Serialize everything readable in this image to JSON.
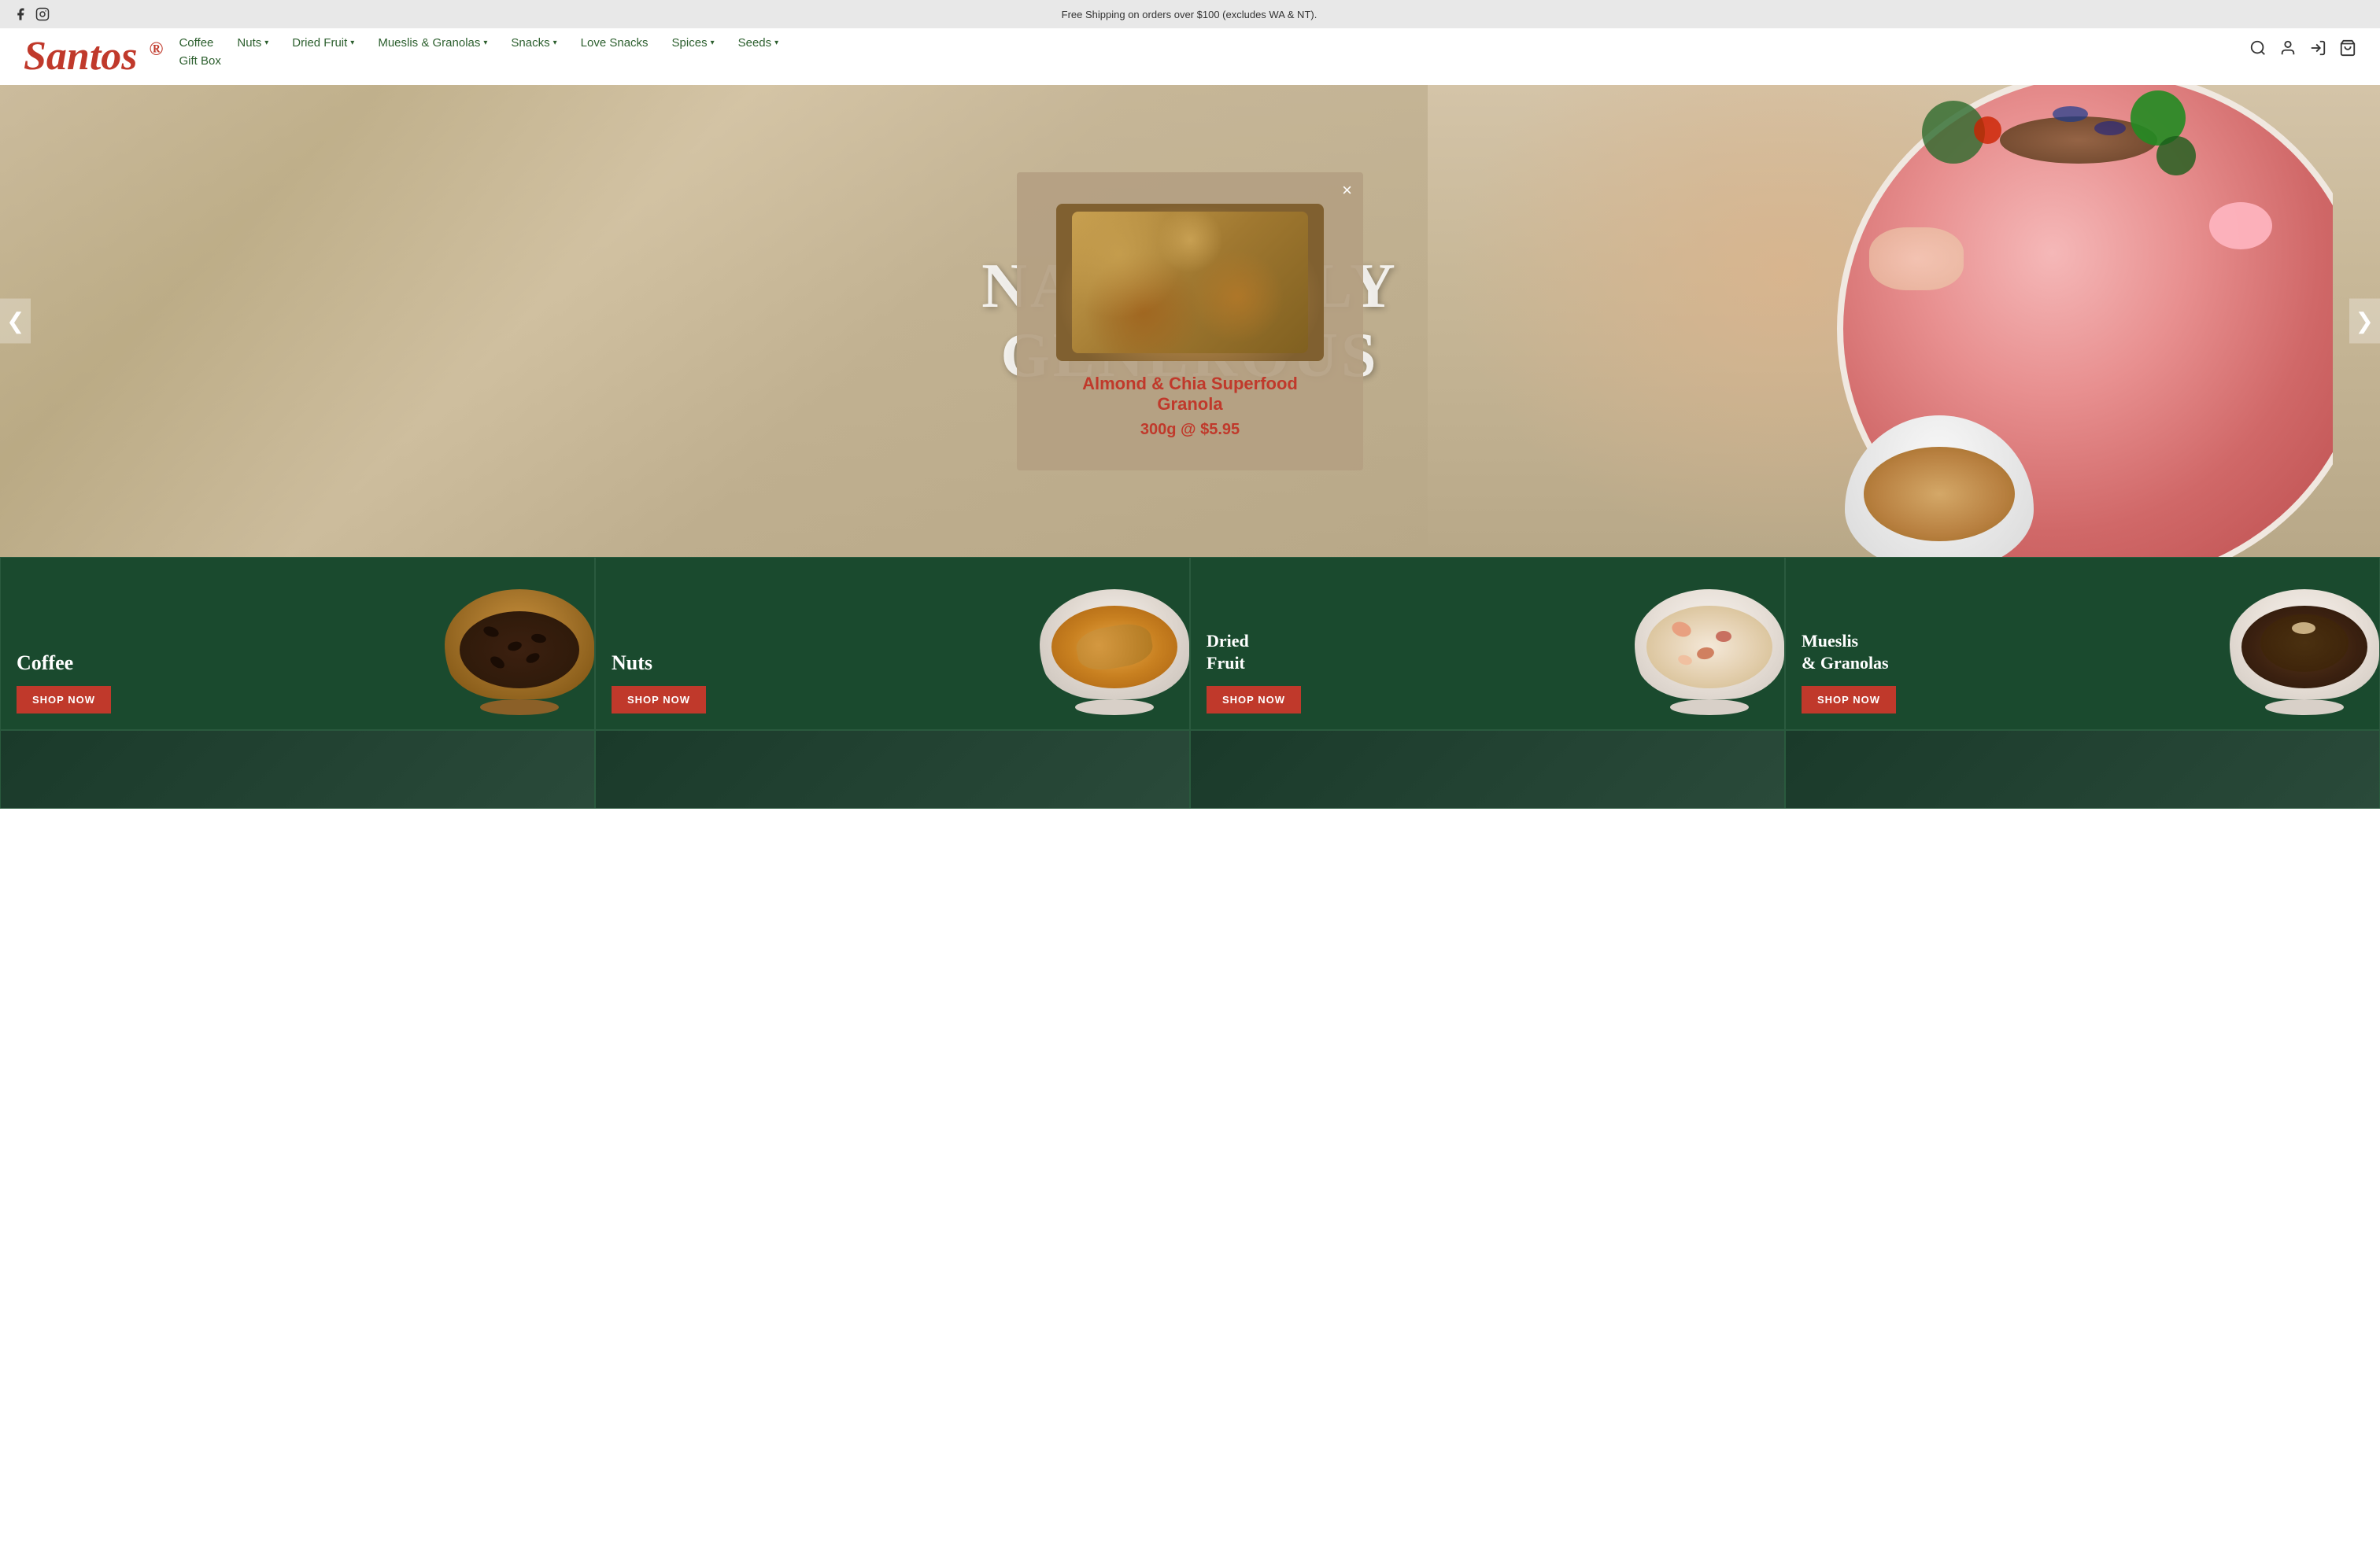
{
  "topbar": {
    "message": "Free Shipping on orders over $100 (excludes WA & NT).",
    "social": [
      "Facebook",
      "Instagram"
    ]
  },
  "header": {
    "logo": "Santos",
    "nav": {
      "items": [
        {
          "label": "Coffee",
          "hasDropdown": false
        },
        {
          "label": "Nuts",
          "hasDropdown": true
        },
        {
          "label": "Dried Fruit",
          "hasDropdown": true
        },
        {
          "label": "Mueslis & Granolas",
          "hasDropdown": true
        },
        {
          "label": "Snacks",
          "hasDropdown": true
        },
        {
          "label": "Love Snacks",
          "hasDropdown": false
        },
        {
          "label": "Spices",
          "hasDropdown": true
        },
        {
          "label": "Seeds",
          "hasDropdown": true
        }
      ],
      "bottom_items": [
        {
          "label": "Gift Box",
          "hasDropdown": false
        }
      ]
    },
    "icons": [
      "search",
      "account",
      "login",
      "cart"
    ]
  },
  "hero": {
    "title_line1": "NATURALLY",
    "title_line2": "GENEROUS",
    "arrow_left": "❮",
    "arrow_right": "❯"
  },
  "popup": {
    "title": "Almond & Chia Superfood Granola",
    "price": "300g @ $5.95",
    "close_label": "×"
  },
  "categories": [
    {
      "title": "Coffee",
      "button": "SHOP NOW"
    },
    {
      "title": "Nuts",
      "button": "SHOP NOW"
    },
    {
      "title": "Dried\nFruit",
      "button": "SHOP NOW"
    },
    {
      "title": "Mueslis\n& Granolas",
      "button": "SHOP NOW"
    }
  ],
  "bottom_categories": [
    {
      "title": ""
    },
    {
      "title": ""
    },
    {
      "title": ""
    },
    {
      "title": ""
    }
  ]
}
